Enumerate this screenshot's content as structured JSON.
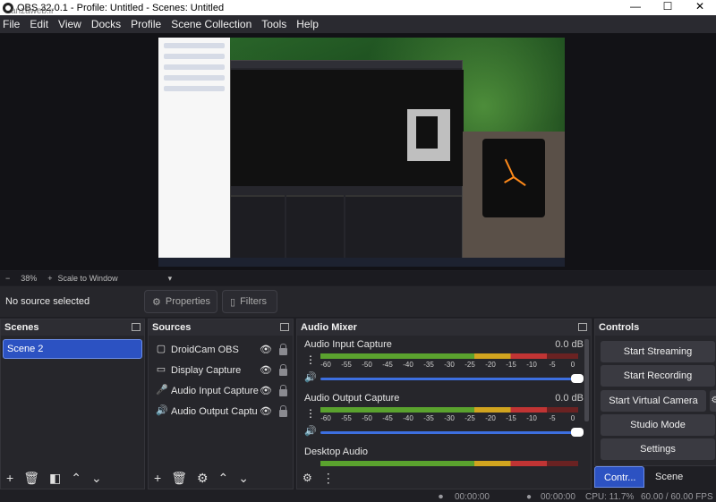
{
  "window": {
    "title": "OBS 32.0.1 - Profile: Untitled - Scenes: Untitled",
    "watermark": "anzaweb.ir",
    "controls": [
      "—",
      "☐",
      "✕"
    ]
  },
  "menubar": [
    "File",
    "Edit",
    "View",
    "Docks",
    "Profile",
    "Scene Collection",
    "Tools",
    "Help"
  ],
  "zoom": {
    "minus": "−",
    "value": "38%",
    "plus": "+",
    "mode": "Scale to Window"
  },
  "sourcebar": {
    "no_source": "No source selected",
    "properties": "Properties",
    "filters": "Filters"
  },
  "scenes": {
    "title": "Scenes",
    "items": [
      "Scene 2"
    ]
  },
  "sources": {
    "title": "Sources",
    "items": [
      {
        "name": "DroidCam OBS",
        "icon": "camera-icon"
      },
      {
        "name": "Display Capture",
        "icon": "monitor-icon"
      },
      {
        "name": "Audio Input Capture",
        "icon": "microphone-icon"
      },
      {
        "name": "Audio Output Captu",
        "icon": "speaker-icon"
      }
    ]
  },
  "mixer": {
    "title": "Audio Mixer",
    "ticks": [
      "-60",
      "-55",
      "-50",
      "-45",
      "-40",
      "-35",
      "-30",
      "-25",
      "-20",
      "-15",
      "-10",
      "-5",
      "0"
    ],
    "channels": [
      {
        "name": "Audio Input Capture",
        "db": "0.0 dB",
        "level": 0.88
      },
      {
        "name": "Audio Output Capture",
        "db": "0.0 dB",
        "level": 0.88
      },
      {
        "name": "Desktop Audio",
        "db": "",
        "level": 0.88
      }
    ]
  },
  "controls": {
    "title": "Controls",
    "buttons": [
      "Start Streaming",
      "Start Recording",
      "Start Virtual Camera",
      "Studio Mode",
      "Settings"
    ]
  },
  "tabs": {
    "active": "Contr...",
    "inactive": "Scene Transitio"
  },
  "status": {
    "time1": "00:00:00",
    "time2": "00:00:00",
    "cpu": "CPU: 11.7%",
    "fps": "60.00 / 60.00 FPS"
  }
}
